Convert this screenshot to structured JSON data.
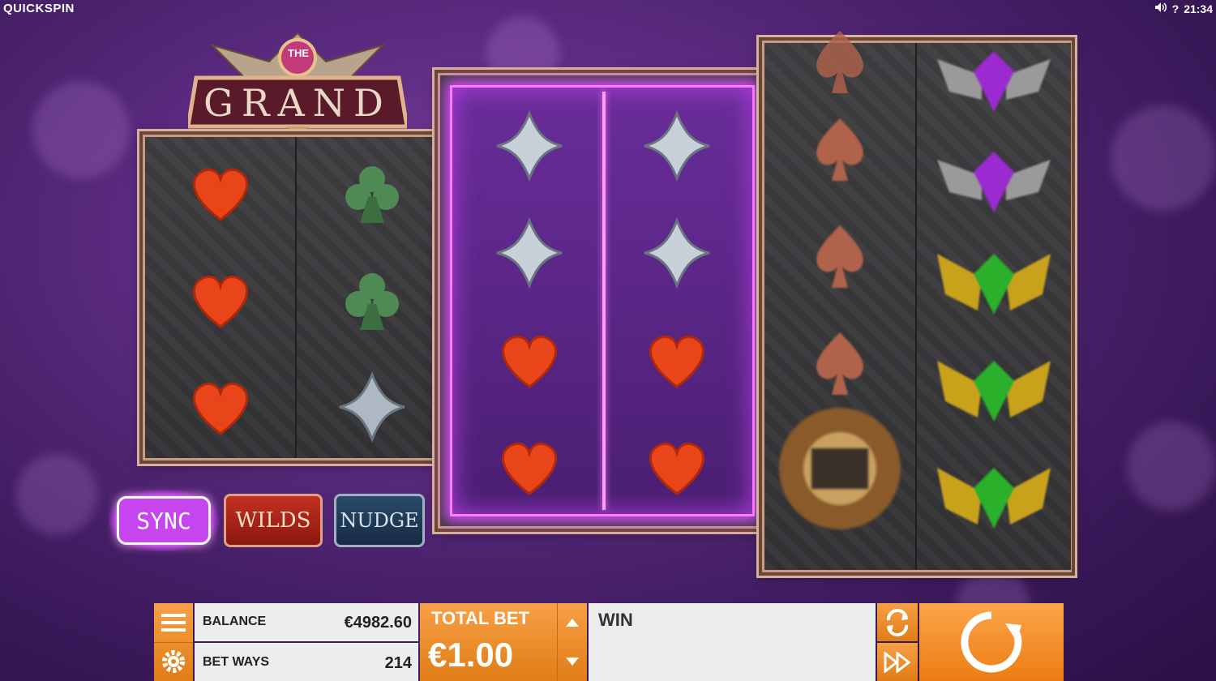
{
  "brand": "QUICKSPIN",
  "top_right": {
    "sound_icon": "speaker-icon",
    "help": "?",
    "time": "21:34"
  },
  "logo": {
    "small": "THE",
    "big": "GRAND"
  },
  "features": {
    "sync": "SYNC",
    "wilds": "WILDS",
    "nudge": "NUDGE"
  },
  "bottom": {
    "balance_label": "BALANCE",
    "balance_value": "€4982.60",
    "betways_label": "BET WAYS",
    "betways_value": "214",
    "totalbet_label": "TOTAL BET",
    "totalbet_value": "€1.00",
    "win_label": "WIN"
  },
  "reels": {
    "reel1": [
      "heart",
      "heart",
      "heart"
    ],
    "reel2": [
      "club",
      "club",
      "diamond"
    ],
    "reel3": [
      "diamond",
      "diamond",
      "heart",
      "heart"
    ],
    "reel4": [
      "diamond",
      "diamond",
      "heart",
      "heart"
    ],
    "reel5": [
      "spade",
      "spade",
      "spade",
      "spade",
      "wild"
    ],
    "reel6": [
      "purple-gem",
      "purple-gem",
      "green-gem",
      "green-gem",
      "green-gem"
    ]
  },
  "colors": {
    "accent": "#f08a24",
    "glow": "#d64cff",
    "frame": "#c89c84"
  }
}
